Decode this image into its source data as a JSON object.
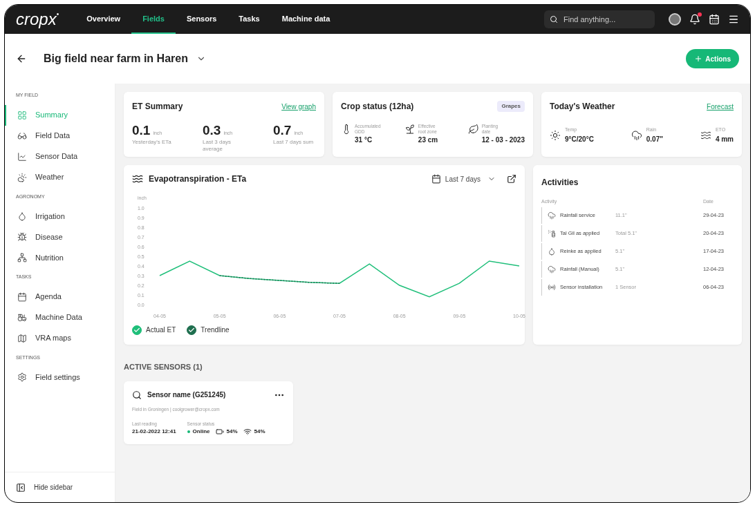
{
  "topbar": {
    "logo": "cropx",
    "logo_mark": "•",
    "tabs": [
      {
        "label": "Overview",
        "selected": false
      },
      {
        "label": "Fields",
        "selected": true
      },
      {
        "label": "Sensors",
        "selected": false
      },
      {
        "label": "Tasks",
        "selected": false
      },
      {
        "label": "Machine data",
        "selected": false
      }
    ],
    "search": {
      "placeholder": "Find anything..."
    },
    "notification_dot": true
  },
  "header": {
    "title": "Big field near farm in Haren",
    "action": "Actions"
  },
  "sidebar": {
    "sections": [
      {
        "title": "MY FIELD",
        "items": [
          {
            "label": "Summary",
            "selected": true
          },
          {
            "label": "Field Data",
            "selected": false
          },
          {
            "label": "Sensor Data",
            "selected": false
          },
          {
            "label": "Weather",
            "selected": false
          }
        ]
      },
      {
        "title": "AGRONOMY",
        "items": [
          {
            "label": "Irrigation",
            "selected": false
          },
          {
            "label": "Disease",
            "selected": false
          },
          {
            "label": "Nutrition",
            "selected": false
          }
        ]
      },
      {
        "title": "TASKS",
        "items": [
          {
            "label": "Agenda",
            "selected": false
          },
          {
            "label": "Machine Data",
            "selected": false
          },
          {
            "label": "VRA maps",
            "selected": false
          }
        ]
      },
      {
        "title": "SETTINGS",
        "items": [
          {
            "label": "Field settings",
            "selected": false
          }
        ]
      }
    ],
    "footer": "Hide sidebar"
  },
  "et_summary": {
    "title": "ET Summary",
    "link": "View graph",
    "metrics": [
      {
        "value": "0.1",
        "unit": "inch",
        "caption": "Yesterday's ETa"
      },
      {
        "value": "0.3",
        "unit": "inch",
        "caption": "Last 3 days average"
      },
      {
        "value": "0.7",
        "unit": "inch",
        "caption": "Last 7 days sum"
      }
    ]
  },
  "crop_status": {
    "title": "Crop status (12ha)",
    "badge": "Grapes",
    "metrics": [
      {
        "label": "Accumulated GDD",
        "value": "31 °C"
      },
      {
        "label": "Effective root zone",
        "value": "23 cm"
      },
      {
        "label": "Planting date",
        "value": "12 - 03 - 2023"
      }
    ]
  },
  "weather": {
    "title": "Today's Weather",
    "link": "Forecast",
    "metrics": [
      {
        "label": "Temp",
        "value": "9°C/20°C"
      },
      {
        "label": "Rain",
        "value": "0.07\""
      },
      {
        "label": "ETO",
        "value": "4 mm"
      }
    ]
  },
  "chart_card": {
    "title": "Evapotranspiration - ETa",
    "range": "Last 7 days",
    "legend": [
      {
        "checked": true
      },
      {
        "checked": true
      }
    ],
    "chart_data": {
      "type": "line",
      "legend": "bottom",
      "ylabel": "inch",
      "categories": [
        "04-05",
        null,
        "05-05",
        null,
        "06-05",
        null,
        "07-05",
        null,
        "08-05",
        null,
        "09-05",
        null,
        "10-05"
      ],
      "ylim": [
        0,
        1
      ],
      "yticks": [
        {
          "value": 0,
          "label": "0.0"
        },
        {
          "value": 0.1,
          "label": "0.1"
        },
        {
          "value": 0.2,
          "label": "0.2"
        },
        {
          "value": 0.3,
          "label": "0.3"
        },
        {
          "value": 0.4,
          "label": "0.4"
        },
        {
          "value": 0.5,
          "label": "0.5"
        },
        {
          "value": 0.6,
          "label": "0.6"
        },
        {
          "value": 0.7,
          "label": "0.7"
        },
        {
          "value": 0.8,
          "label": "0.8"
        },
        {
          "value": 0.9,
          "label": "0.9"
        },
        {
          "value": 1,
          "label": "1.0"
        }
      ],
      "series": [
        {
          "name": "Actual ET",
          "color": "#1fbf7a",
          "line_style": "solid",
          "values": [
            0.3,
            0.45,
            0.3,
            0.27,
            0.25,
            0.23,
            0.22,
            0.42,
            0.2,
            0.08,
            0.22,
            0.45,
            0.4
          ]
        },
        {
          "name": "Trendline",
          "color": "#1f6f4f",
          "line_style": "dashed",
          "values": [
            null,
            null,
            0.3,
            0.27,
            0.25,
            0.23,
            0.22,
            null,
            null,
            null,
            null,
            null,
            null
          ]
        }
      ]
    }
  },
  "activities": {
    "title": "Activities",
    "columns": [
      "Activity",
      "Date"
    ],
    "rows": [
      {
        "name": "Rainfall service",
        "amount": "11.1\"",
        "date": "29-04-23"
      },
      {
        "name": "Tal Gil as applied",
        "amount": "Total 5.1\"",
        "date": "20-04-23"
      },
      {
        "name": "Reinke as applied",
        "amount": "5.1\"",
        "date": "17-04-23"
      },
      {
        "name": "Rainfall (Manual)",
        "amount": "5.1\"",
        "date": "12-04-23"
      },
      {
        "name": "Sensor installation",
        "amount": "1 Sensor",
        "date": "06-04-23"
      }
    ]
  },
  "sensors": {
    "title": "ACTIVE SENSORS (1)",
    "cards": [
      {
        "name": "Sensor name (G251245)",
        "subtitle": "Field in Groningen | coolgrower@cropx.com",
        "reading_label": "Last reading",
        "reading": "21-02-2022 12:41",
        "status_label": "Sensor status",
        "status": "Online",
        "online": true,
        "battery": "54%",
        "signal": "54%"
      }
    ]
  }
}
